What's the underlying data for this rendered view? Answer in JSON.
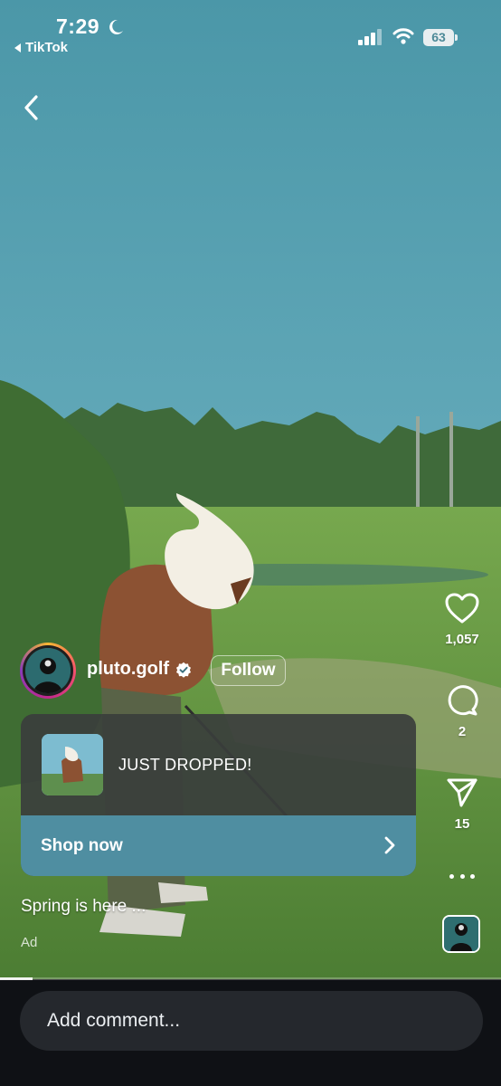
{
  "status_bar": {
    "time": "7:29",
    "back_app_label": "TikTok",
    "battery": "63"
  },
  "post": {
    "username": "pluto.golf",
    "follow_label": "Follow",
    "caption": "Spring is here ...",
    "ad_label": "Ad",
    "verified": true
  },
  "ad_card": {
    "headline": "JUST DROPPED!",
    "cta_label": "Shop now"
  },
  "actions": {
    "likes": "1,057",
    "comments": "2",
    "shares": "15"
  },
  "comment_bar": {
    "placeholder": "Add comment..."
  },
  "video": {
    "progress": 0.065
  },
  "colors": {
    "accent_cta": "#4f8ea1",
    "sky": "#5aa0b0",
    "grass": "#5e8f45"
  }
}
